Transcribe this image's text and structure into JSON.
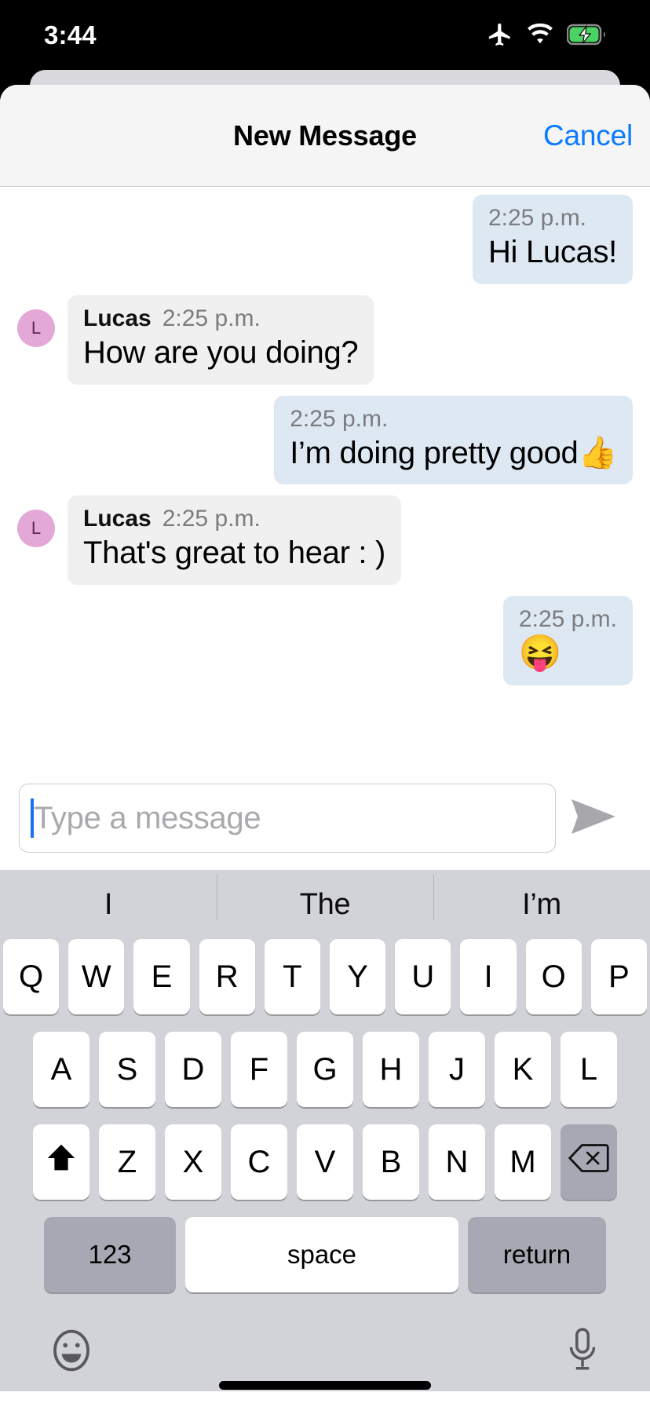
{
  "status_bar": {
    "time": "3:44",
    "icons": [
      "airplane-icon",
      "wifi-icon",
      "battery-charging-icon"
    ],
    "battery_color": "#4cd264"
  },
  "sheet": {
    "title": "New Message",
    "cancel_label": "Cancel",
    "cancel_color": "#0a7bff"
  },
  "conversation": {
    "messages": [
      {
        "direction": "sent",
        "sender": "",
        "time": "2:25 p.m.",
        "text": "Hi Lucas!"
      },
      {
        "direction": "received",
        "sender": "Lucas",
        "time": "2:25 p.m.",
        "text": "How are you doing?",
        "avatar_letter": "L"
      },
      {
        "direction": "sent",
        "sender": "",
        "time": "2:25 p.m.",
        "text": "I’m doing pretty good👍"
      },
      {
        "direction": "received",
        "sender": "Lucas",
        "time": "2:25 p.m.",
        "text": "That's great to hear : )",
        "avatar_letter": "L"
      },
      {
        "direction": "sent",
        "sender": "",
        "time": "2:25 p.m.",
        "text": "😝",
        "emoji_only": true
      }
    ],
    "bubble_sent_color": "#dde8f3",
    "bubble_received_color": "#f0f0f0",
    "avatar_color": "#e4a8d7"
  },
  "composer": {
    "placeholder": "Type a message",
    "value": "",
    "send_icon": "send-arrow-icon",
    "caret_color": "#1a6ef5"
  },
  "keyboard": {
    "suggestions": [
      "I",
      "The",
      "I’m"
    ],
    "row1": [
      "Q",
      "W",
      "E",
      "R",
      "T",
      "Y",
      "U",
      "I",
      "O",
      "P"
    ],
    "row2": [
      "A",
      "S",
      "D",
      "F",
      "G",
      "H",
      "J",
      "K",
      "L"
    ],
    "row3": [
      "Z",
      "X",
      "C",
      "V",
      "B",
      "N",
      "M"
    ],
    "shift_icon": "shift-up-arrow-icon",
    "backspace_icon": "backspace-icon",
    "numbers_label": "123",
    "space_label": "space",
    "return_label": "return",
    "emoji_icon": "emoji-smiley-icon",
    "dictation_icon": "microphone-icon",
    "background_color": "#d1d3d9"
  }
}
